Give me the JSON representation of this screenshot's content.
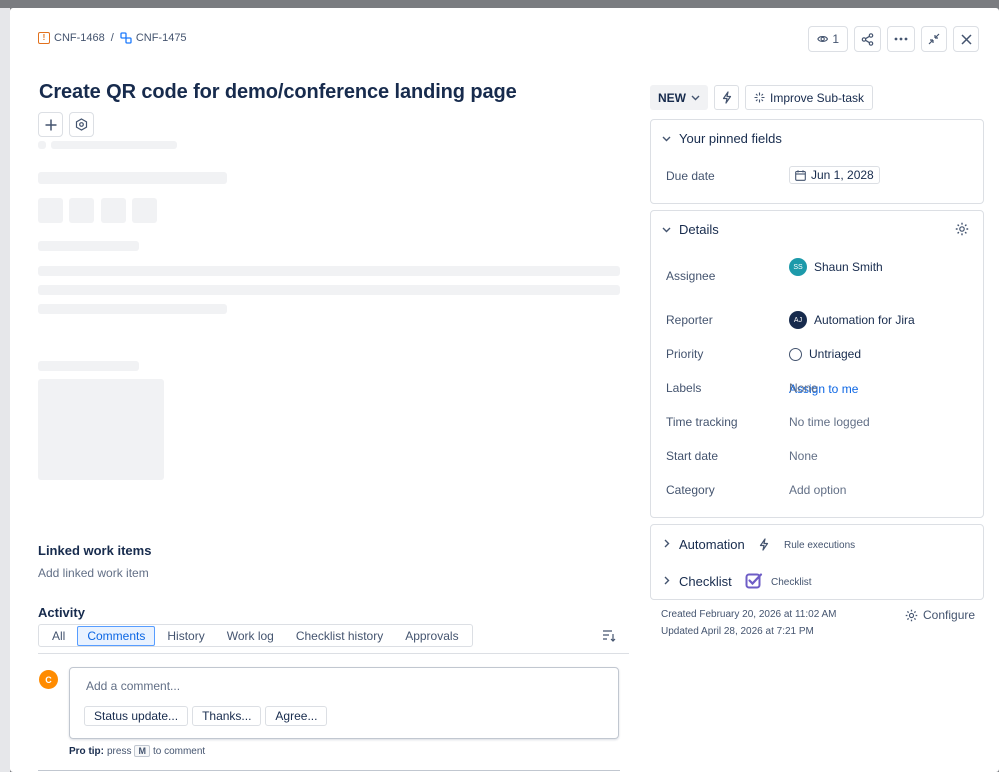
{
  "breadcrumb": {
    "parent_key": "CNF-1468",
    "separator": "/",
    "current_key": "CNF-1475"
  },
  "toolbar": {
    "watchers_count": "1"
  },
  "issue": {
    "title": "Create QR code for demo/conference landing page"
  },
  "linked": {
    "heading": "Linked work items",
    "add_label": "Add linked work item"
  },
  "activity": {
    "heading": "Activity",
    "tabs": [
      "All",
      "Comments",
      "History",
      "Work log",
      "Checklist history",
      "Approvals"
    ],
    "active_tab": "Comments",
    "avatar_initial": "C",
    "comment_placeholder": "Add a comment...",
    "quick_replies": [
      "Status update...",
      "Thanks...",
      "Agree..."
    ],
    "protip_bold": "Pro tip:",
    "protip_pre": "press",
    "protip_key": "M",
    "protip_post": "to comment"
  },
  "status": {
    "label": "NEW",
    "improve_label": "Improve Sub-task"
  },
  "pinned": {
    "heading": "Your pinned fields",
    "due_label": "Due date",
    "due_value": "Jun 1, 2028"
  },
  "details": {
    "heading": "Details",
    "assignee_label": "Assignee",
    "assignee_initials": "SS",
    "assignee_name": "Shaun Smith",
    "assign_to_me": "Assign to me",
    "reporter_label": "Reporter",
    "reporter_initials": "AJ",
    "reporter_name": "Automation for Jira",
    "priority_label": "Priority",
    "priority_value": "Untriaged",
    "labels_label": "Labels",
    "labels_value": "None",
    "time_label": "Time tracking",
    "time_value": "No time logged",
    "start_label": "Start date",
    "start_value": "None",
    "category_label": "Category",
    "category_value": "Add option"
  },
  "automation": {
    "heading": "Automation",
    "note": "Rule executions"
  },
  "checklist": {
    "heading": "Checklist",
    "note": "Checklist"
  },
  "meta": {
    "created": "Created February 20, 2026 at 11:02 AM",
    "updated": "Updated April 28, 2026 at 7:21 PM",
    "configure": "Configure"
  },
  "colors": {
    "accent": "#0c66e4",
    "bug_orange": "#e2711d",
    "assignee_avatar": "#1d9aaa",
    "comment_avatar": "#ff8b00",
    "checklist_purple": "#6e5dc6"
  }
}
